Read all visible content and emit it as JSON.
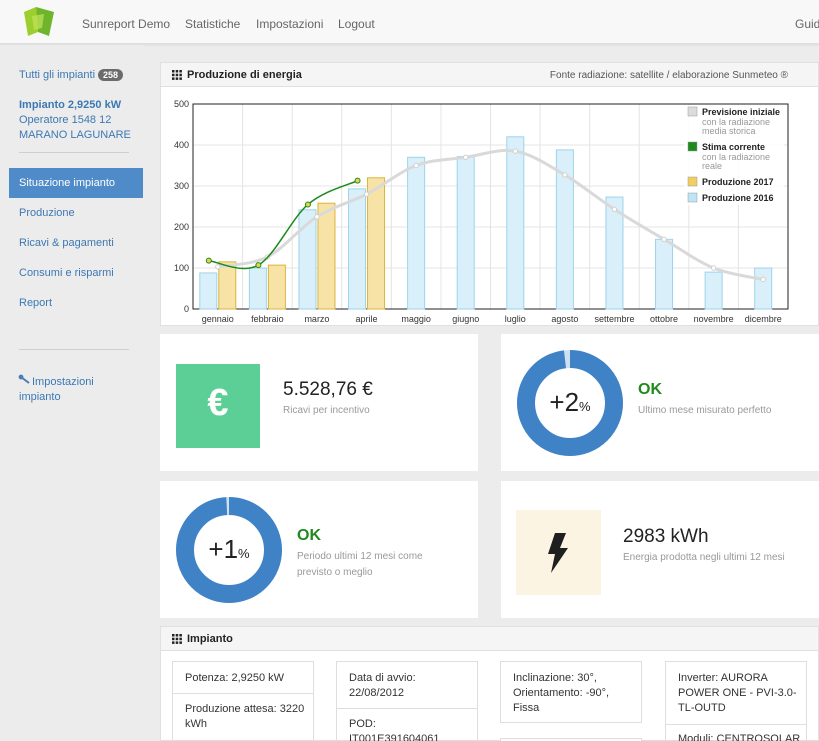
{
  "nav": {
    "items": [
      "Sunreport Demo",
      "Statistiche",
      "Impostazioni",
      "Logout",
      "Guid"
    ]
  },
  "sidebar": {
    "all_plants_label": "Tutti gli impianti",
    "all_plants_count": "258",
    "plant_name": "Impianto 2,9250 kW",
    "operator": "Operatore 1548 12",
    "location": "MARANO LAGUNARE",
    "menu": [
      "Situazione impianto",
      "Produzione",
      "Ricavi & pagamenti",
      "Consumi e risparmi",
      "Report"
    ],
    "settings_line1": "Impostazioni",
    "settings_line2": "impianto"
  },
  "energy_panel": {
    "title": "Produzione di energia",
    "source": "Fonte radiazione: satellite / elaborazione Sunmeteo ®"
  },
  "chart_data": {
    "type": "bar",
    "categories": [
      "gennaio",
      "febbraio",
      "marzo",
      "aprile",
      "maggio",
      "giugno",
      "luglio",
      "agosto",
      "settembre",
      "ottobre",
      "novembre",
      "dicembre"
    ],
    "ylim": [
      0,
      500
    ],
    "yticks": [
      "0",
      "100",
      "200",
      "300",
      "400",
      "500"
    ],
    "grid": true,
    "legend_position": "top-right",
    "series": [
      {
        "name": "Produzione 2016",
        "kind": "bar",
        "color": "#d9effa",
        "border": "#9ed3ec",
        "values": [
          88,
          100,
          242,
          293,
          370,
          372,
          420,
          388,
          273,
          170,
          90,
          100
        ]
      },
      {
        "name": "Produzione 2017",
        "kind": "bar",
        "color": "#f7e3a6",
        "border": "#dcb43c",
        "values": [
          115,
          107,
          258,
          320,
          null,
          null,
          null,
          null,
          null,
          null,
          null,
          null
        ]
      },
      {
        "name": "Previsione iniziale",
        "kind": "line",
        "color": "#d9d9d9",
        "values": [
          103,
          127,
          225,
          280,
          350,
          370,
          385,
          327,
          243,
          170,
          100,
          72
        ]
      },
      {
        "name": "Stima corrente",
        "kind": "line",
        "color": "#1c8a1c",
        "values": [
          118,
          107,
          255,
          313,
          null,
          null,
          null,
          null,
          null,
          null,
          null,
          null
        ]
      }
    ],
    "legend": [
      {
        "label": "Previsione iniziale",
        "sub1": "con la radiazione",
        "sub2": "media storica",
        "color": "#dcdcdc"
      },
      {
        "label": "Stima corrente",
        "sub1": "con la radiazione",
        "sub2": "reale",
        "color": "#1c8a1c"
      },
      {
        "label": "Produzione 2017",
        "sub1": "",
        "sub2": "",
        "color": "#f0cf5e"
      },
      {
        "label": "Produzione 2016",
        "sub1": "",
        "sub2": "",
        "color": "#bfe4f5"
      }
    ]
  },
  "cards": {
    "revenue": {
      "value": "5.528,76 €",
      "label": "Ricavi per incentivo",
      "icon": "euro-icon",
      "color": "#5ccf96"
    },
    "month": {
      "percent": "+2",
      "unit": "%",
      "status": "OK",
      "label": "Ultimo mese misurato perfetto",
      "fill": 0.98,
      "color": "#3f82c6"
    },
    "year": {
      "percent": "+1",
      "unit": "%",
      "status": "OK",
      "label1": "Periodo ultimi 12 mesi come",
      "label2": "previsto o meglio",
      "fill": 0.99,
      "color": "#3f82c6"
    },
    "energy": {
      "value": "2983 kWh",
      "label": "Energia prodotta negli ultimi 12 mesi",
      "icon": "lightning-icon",
      "color": "#fbf4e2"
    }
  },
  "plant_panel": {
    "title": "Impianto",
    "power": "Potenza: 2,9250 kW",
    "expected_1": "Produzione attesa: 3220",
    "expected_2": "kWh",
    "start_1": "Data di avvio:",
    "start_2": "22/08/2012",
    "pod_1": "POD:",
    "pod_2": "IT001E391604061",
    "incl_1": "Inclinazione: 30°,",
    "incl_2": "Orientamento: -90°,",
    "incl_3": "Fissa",
    "inv_1": "Inverter: AURORA",
    "inv_2": "POWER ONE - PVI-3.0-",
    "inv_3": "TL-OUTD",
    "mod_1": "Moduli: CENTROSOLAR"
  }
}
